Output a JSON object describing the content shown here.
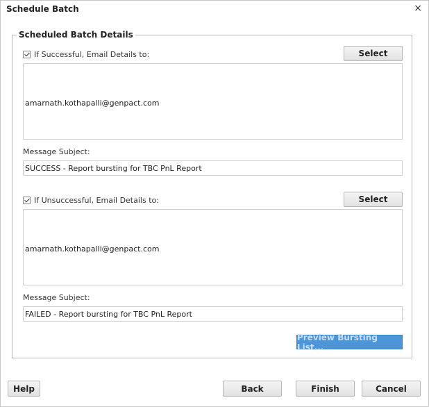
{
  "dialog": {
    "title": "Schedule Batch",
    "close_glyph": "×"
  },
  "group": {
    "legend": "Scheduled Batch Details",
    "success": {
      "checked": true,
      "label": "If Successful, Email Details to:",
      "select_label": "Select",
      "email": "amarnath.kothapalli@genpact.com",
      "subject_label": "Message Subject:",
      "subject_value": "SUCCESS - Report bursting for TBC PnL Report"
    },
    "failure": {
      "checked": true,
      "label": "If Unsuccessful, Email Details to:",
      "select_label": "Select",
      "email": "amarnath.kothapalli@genpact.com",
      "subject_label": "Message Subject:",
      "subject_value": "FAILED - Report bursting for TBC PnL Report"
    },
    "preview_label": "Preview Bursting List..."
  },
  "footer": {
    "help_label": "Help",
    "back_label": "Back",
    "finish_label": "Finish",
    "cancel_label": "Cancel"
  },
  "colors": {
    "preview_button": "#4d95d9",
    "border": "#cfcfcf"
  },
  "icons": {
    "close": "close-icon",
    "checkbox": "checkbox-checked-icon"
  }
}
